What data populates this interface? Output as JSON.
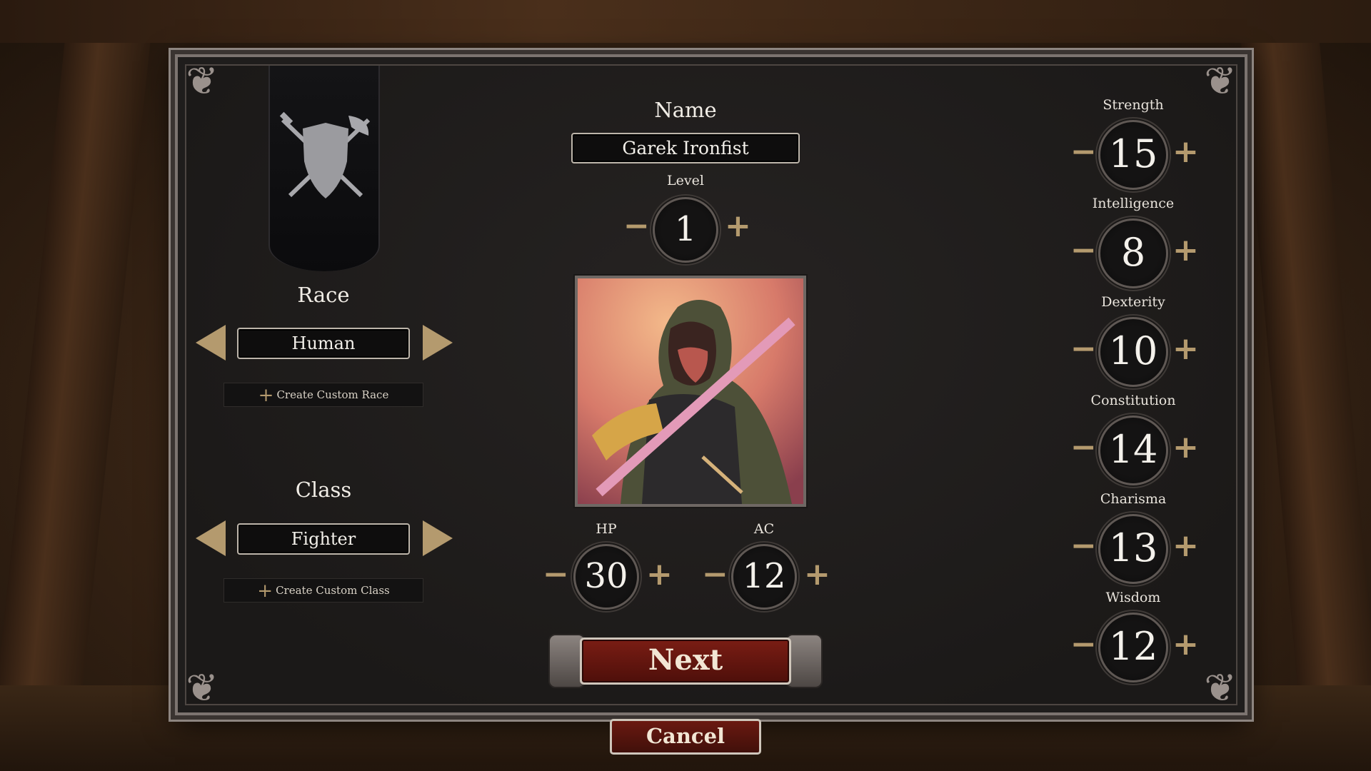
{
  "left": {
    "race_heading": "Race",
    "race_value": "Human",
    "create_race_label": "Create Custom Race",
    "class_heading": "Class",
    "class_value": "Fighter",
    "create_class_label": "Create Custom Class"
  },
  "center": {
    "name_heading": "Name",
    "name_value": "Garek Ironfist",
    "level_heading": "Level",
    "level_value": "1",
    "hp_heading": "HP",
    "hp_value": "30",
    "ac_heading": "AC",
    "ac_value": "12",
    "next_label": "Next",
    "cancel_label": "Cancel"
  },
  "stats": [
    {
      "label": "Strength",
      "value": "15"
    },
    {
      "label": "Intelligence",
      "value": "8"
    },
    {
      "label": "Dexterity",
      "value": "10"
    },
    {
      "label": "Constitution",
      "value": "14"
    },
    {
      "label": "Charisma",
      "value": "13"
    },
    {
      "label": "Wisdom",
      "value": "12"
    }
  ],
  "icons": {
    "banner_emblem": "crossed-sword-axe-shield-icon",
    "plus": "plus-icon",
    "minus": "minus-icon",
    "arrow_left": "arrow-left-icon",
    "arrow_right": "arrow-right-icon"
  },
  "colors": {
    "accent_gold": "#b49a6e",
    "button_red": "#7a1d14",
    "panel_bg": "#1f1d1c"
  }
}
